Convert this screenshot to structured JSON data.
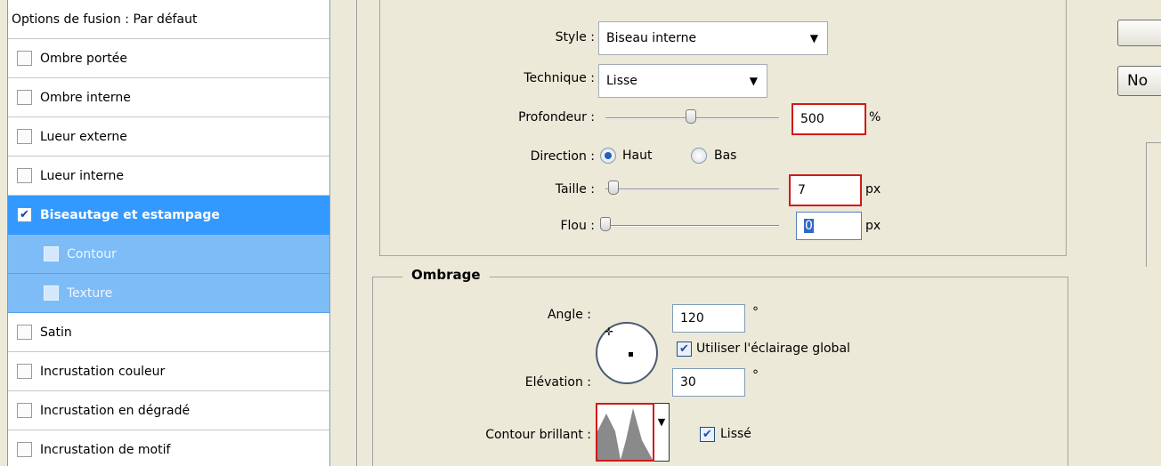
{
  "style_list": {
    "header": "Options de fusion : Par défaut",
    "items": [
      {
        "label": "Ombre portée",
        "checked": false
      },
      {
        "label": "Ombre interne",
        "checked": false
      },
      {
        "label": "Lueur externe",
        "checked": false
      },
      {
        "label": "Lueur interne",
        "checked": false
      },
      {
        "label": "Biseautage et estampage",
        "checked": true
      },
      {
        "label": "Contour",
        "checked": false
      },
      {
        "label": "Texture",
        "checked": false
      },
      {
        "label": "Satin",
        "checked": false
      },
      {
        "label": "Incrustation couleur",
        "checked": false
      },
      {
        "label": "Incrustation en dégradé",
        "checked": false
      },
      {
        "label": "Incrustation de motif",
        "checked": false
      }
    ]
  },
  "bevel": {
    "style_label": "Style :",
    "style_value": "Biseau interne",
    "technique_label": "Technique :",
    "technique_value": "Lisse",
    "depth_label": "Profondeur :",
    "depth_value": "500",
    "depth_unit": "%",
    "direction_label": "Direction :",
    "direction_up": "Haut",
    "direction_down": "Bas",
    "direction_selected": "Haut",
    "size_label": "Taille :",
    "size_value": "7",
    "size_unit": "px",
    "soften_label": "Flou :",
    "soften_value": "0",
    "soften_unit": "px"
  },
  "shading": {
    "title": "Ombrage",
    "angle_label": "Angle :",
    "angle_value": "120",
    "angle_unit": "°",
    "global_light_label": "Utiliser l'éclairage global",
    "global_light_checked": true,
    "altitude_label": "Elévation :",
    "altitude_value": "30",
    "altitude_unit": "°",
    "gloss_label": "Contour brillant :",
    "antialias_label": "Lissé",
    "antialias_checked": true
  },
  "buttons": {
    "top_button": "",
    "new_style_partial": "No"
  },
  "colors": {
    "selected": "#3399ff",
    "sub_selected": "#7dbcf7",
    "highlight_red": "#d11a1a"
  }
}
